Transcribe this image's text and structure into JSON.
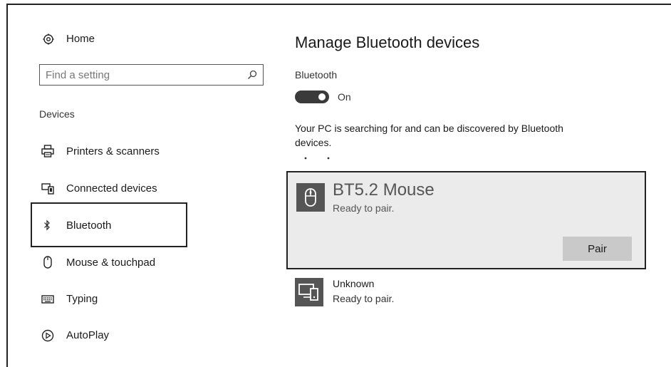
{
  "sidebar": {
    "home_label": "Home",
    "search_placeholder": "Find a setting",
    "section_label": "Devices",
    "items": [
      {
        "label": "Printers & scanners",
        "icon": "printer-icon"
      },
      {
        "label": "Connected devices",
        "icon": "connected-devices-icon"
      },
      {
        "label": "Bluetooth",
        "icon": "bluetooth-icon",
        "selected": true
      },
      {
        "label": "Mouse & touchpad",
        "icon": "mouse-icon"
      },
      {
        "label": "Typing",
        "icon": "keyboard-icon"
      },
      {
        "label": "AutoPlay",
        "icon": "autoplay-icon"
      }
    ]
  },
  "main": {
    "title": "Manage Bluetooth devices",
    "bluetooth_label": "Bluetooth",
    "toggle_state": "On",
    "status_line1": "Your PC is searching for and can be discovered by Bluetooth",
    "status_line2": "devices.",
    "devices": [
      {
        "name": "BT5.2 Mouse",
        "status": "Ready to pair.",
        "icon": "mouse-device-icon",
        "button": "Pair"
      },
      {
        "name": "Unknown",
        "status": "Ready to pair.",
        "icon": "computer-phone-icon"
      }
    ]
  }
}
